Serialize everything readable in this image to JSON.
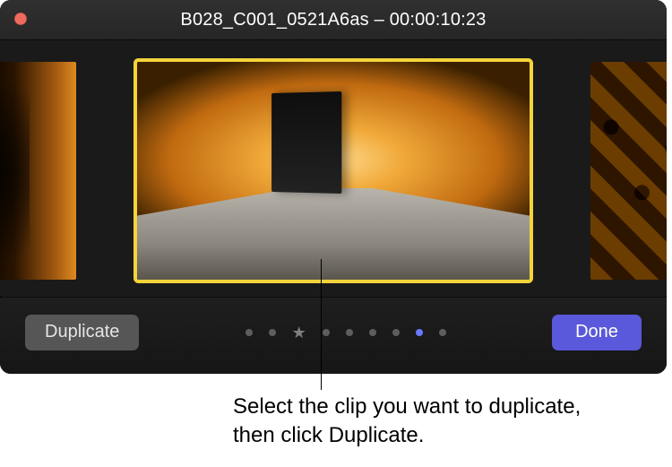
{
  "window": {
    "title": "B028_C001_0521A6as – 00:00:10:23",
    "close_color": "#ed6a5e"
  },
  "clips": {
    "selected_index": 1,
    "selection_color": "#f3d43a"
  },
  "controls": {
    "duplicate_label": "Duplicate",
    "done_label": "Done",
    "accent_color": "#5a58db",
    "paging": {
      "count": 9,
      "favorite_index": 2,
      "active_index": 7
    }
  },
  "annotation": {
    "text": "Select the clip you want to duplicate, then click Duplicate."
  }
}
